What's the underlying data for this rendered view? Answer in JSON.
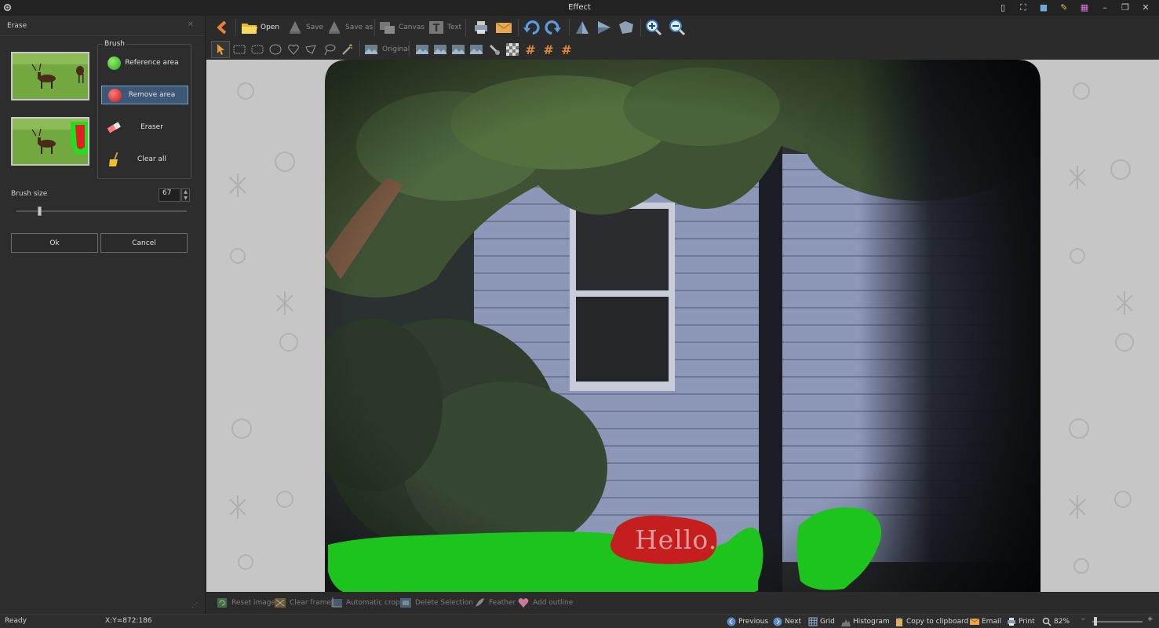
{
  "window": {
    "title": "Effect"
  },
  "left_panel": {
    "title": "Erase",
    "brush_group": {
      "legend": "Brush",
      "items": [
        {
          "label": "Reference area",
          "icon": "green-circle-icon",
          "color": "#3fbf2a",
          "selected": false
        },
        {
          "label": "Remove area",
          "icon": "red-circle-icon",
          "color": "#e03030",
          "selected": true
        },
        {
          "label": "Eraser",
          "icon": "eraser-icon",
          "selected": false
        },
        {
          "label": "Clear all",
          "icon": "broom-icon",
          "selected": false
        }
      ]
    },
    "brush_size": {
      "label": "Brush size",
      "value": "67"
    },
    "buttons": {
      "ok": "Ok",
      "cancel": "Cancel"
    }
  },
  "toolbar": {
    "open": "Open",
    "save": "Save",
    "save_as": "Save as",
    "canvas": "Canvas",
    "text": "Text",
    "original": "Original"
  },
  "canvas": {
    "overlay_text": "Hello."
  },
  "actions": {
    "reset_image": "Reset image",
    "clear_frame": "Clear frame",
    "automatic_crop": "Automatic crop",
    "delete_selection": "Delete Selection",
    "feather": "Feather",
    "add_outline": "Add outline"
  },
  "status": {
    "state": "Ready",
    "coords": "X:Y=872:186",
    "previous": "Previous",
    "next": "Next",
    "grid": "Grid",
    "histogram": "Histogram",
    "copy": "Copy to clipboard",
    "email": "Email",
    "print": "Print",
    "zoom": "82%"
  },
  "colors": {
    "accent": "#3d5874",
    "reference_green": "#22cc22",
    "remove_red": "#cc2020"
  }
}
